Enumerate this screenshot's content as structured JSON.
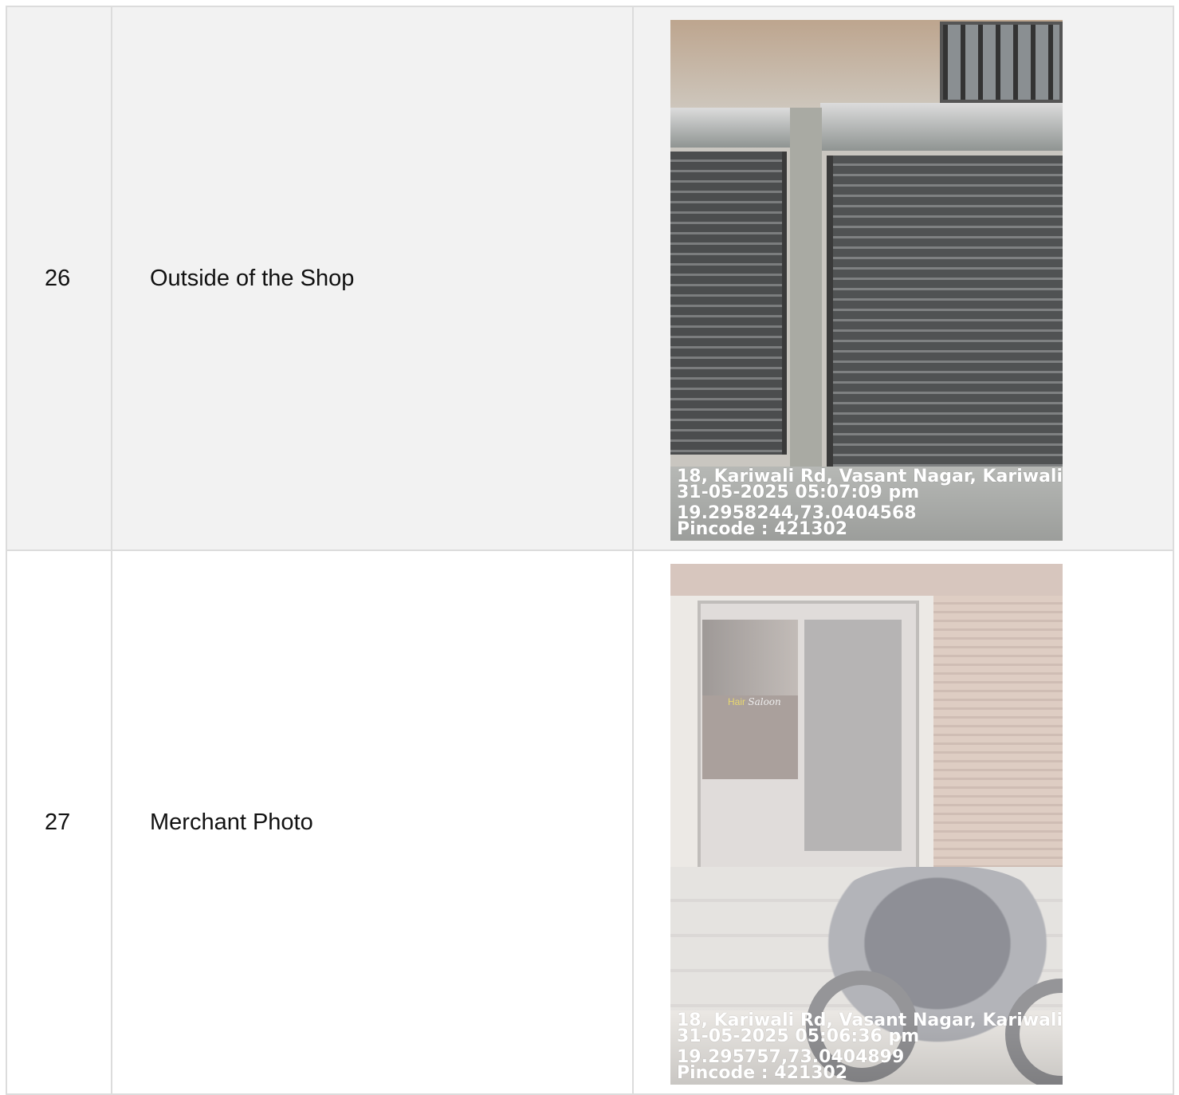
{
  "rows": [
    {
      "number": "26",
      "label": "Outside of the Shop",
      "photo_overlay": {
        "address": "18, Kariwali Rd, Vasant Nagar, Kariwali, ...",
        "datetime": "31-05-2025 05:07:09 pm",
        "coords": "19.2958244,73.0404568",
        "pincode": "Pincode : 421302"
      }
    },
    {
      "number": "27",
      "label": "Merchant Photo",
      "photo_overlay": {
        "address": "18, Kariwali Rd, Vasant Nagar, Kariwali, ...",
        "datetime": "31-05-2025 05:06:36 pm",
        "coords": "19.295757,73.0404899",
        "pincode": "Pincode : 421302"
      },
      "photo_sign": {
        "word1": "Hair",
        "word2": "Saloon"
      }
    }
  ]
}
